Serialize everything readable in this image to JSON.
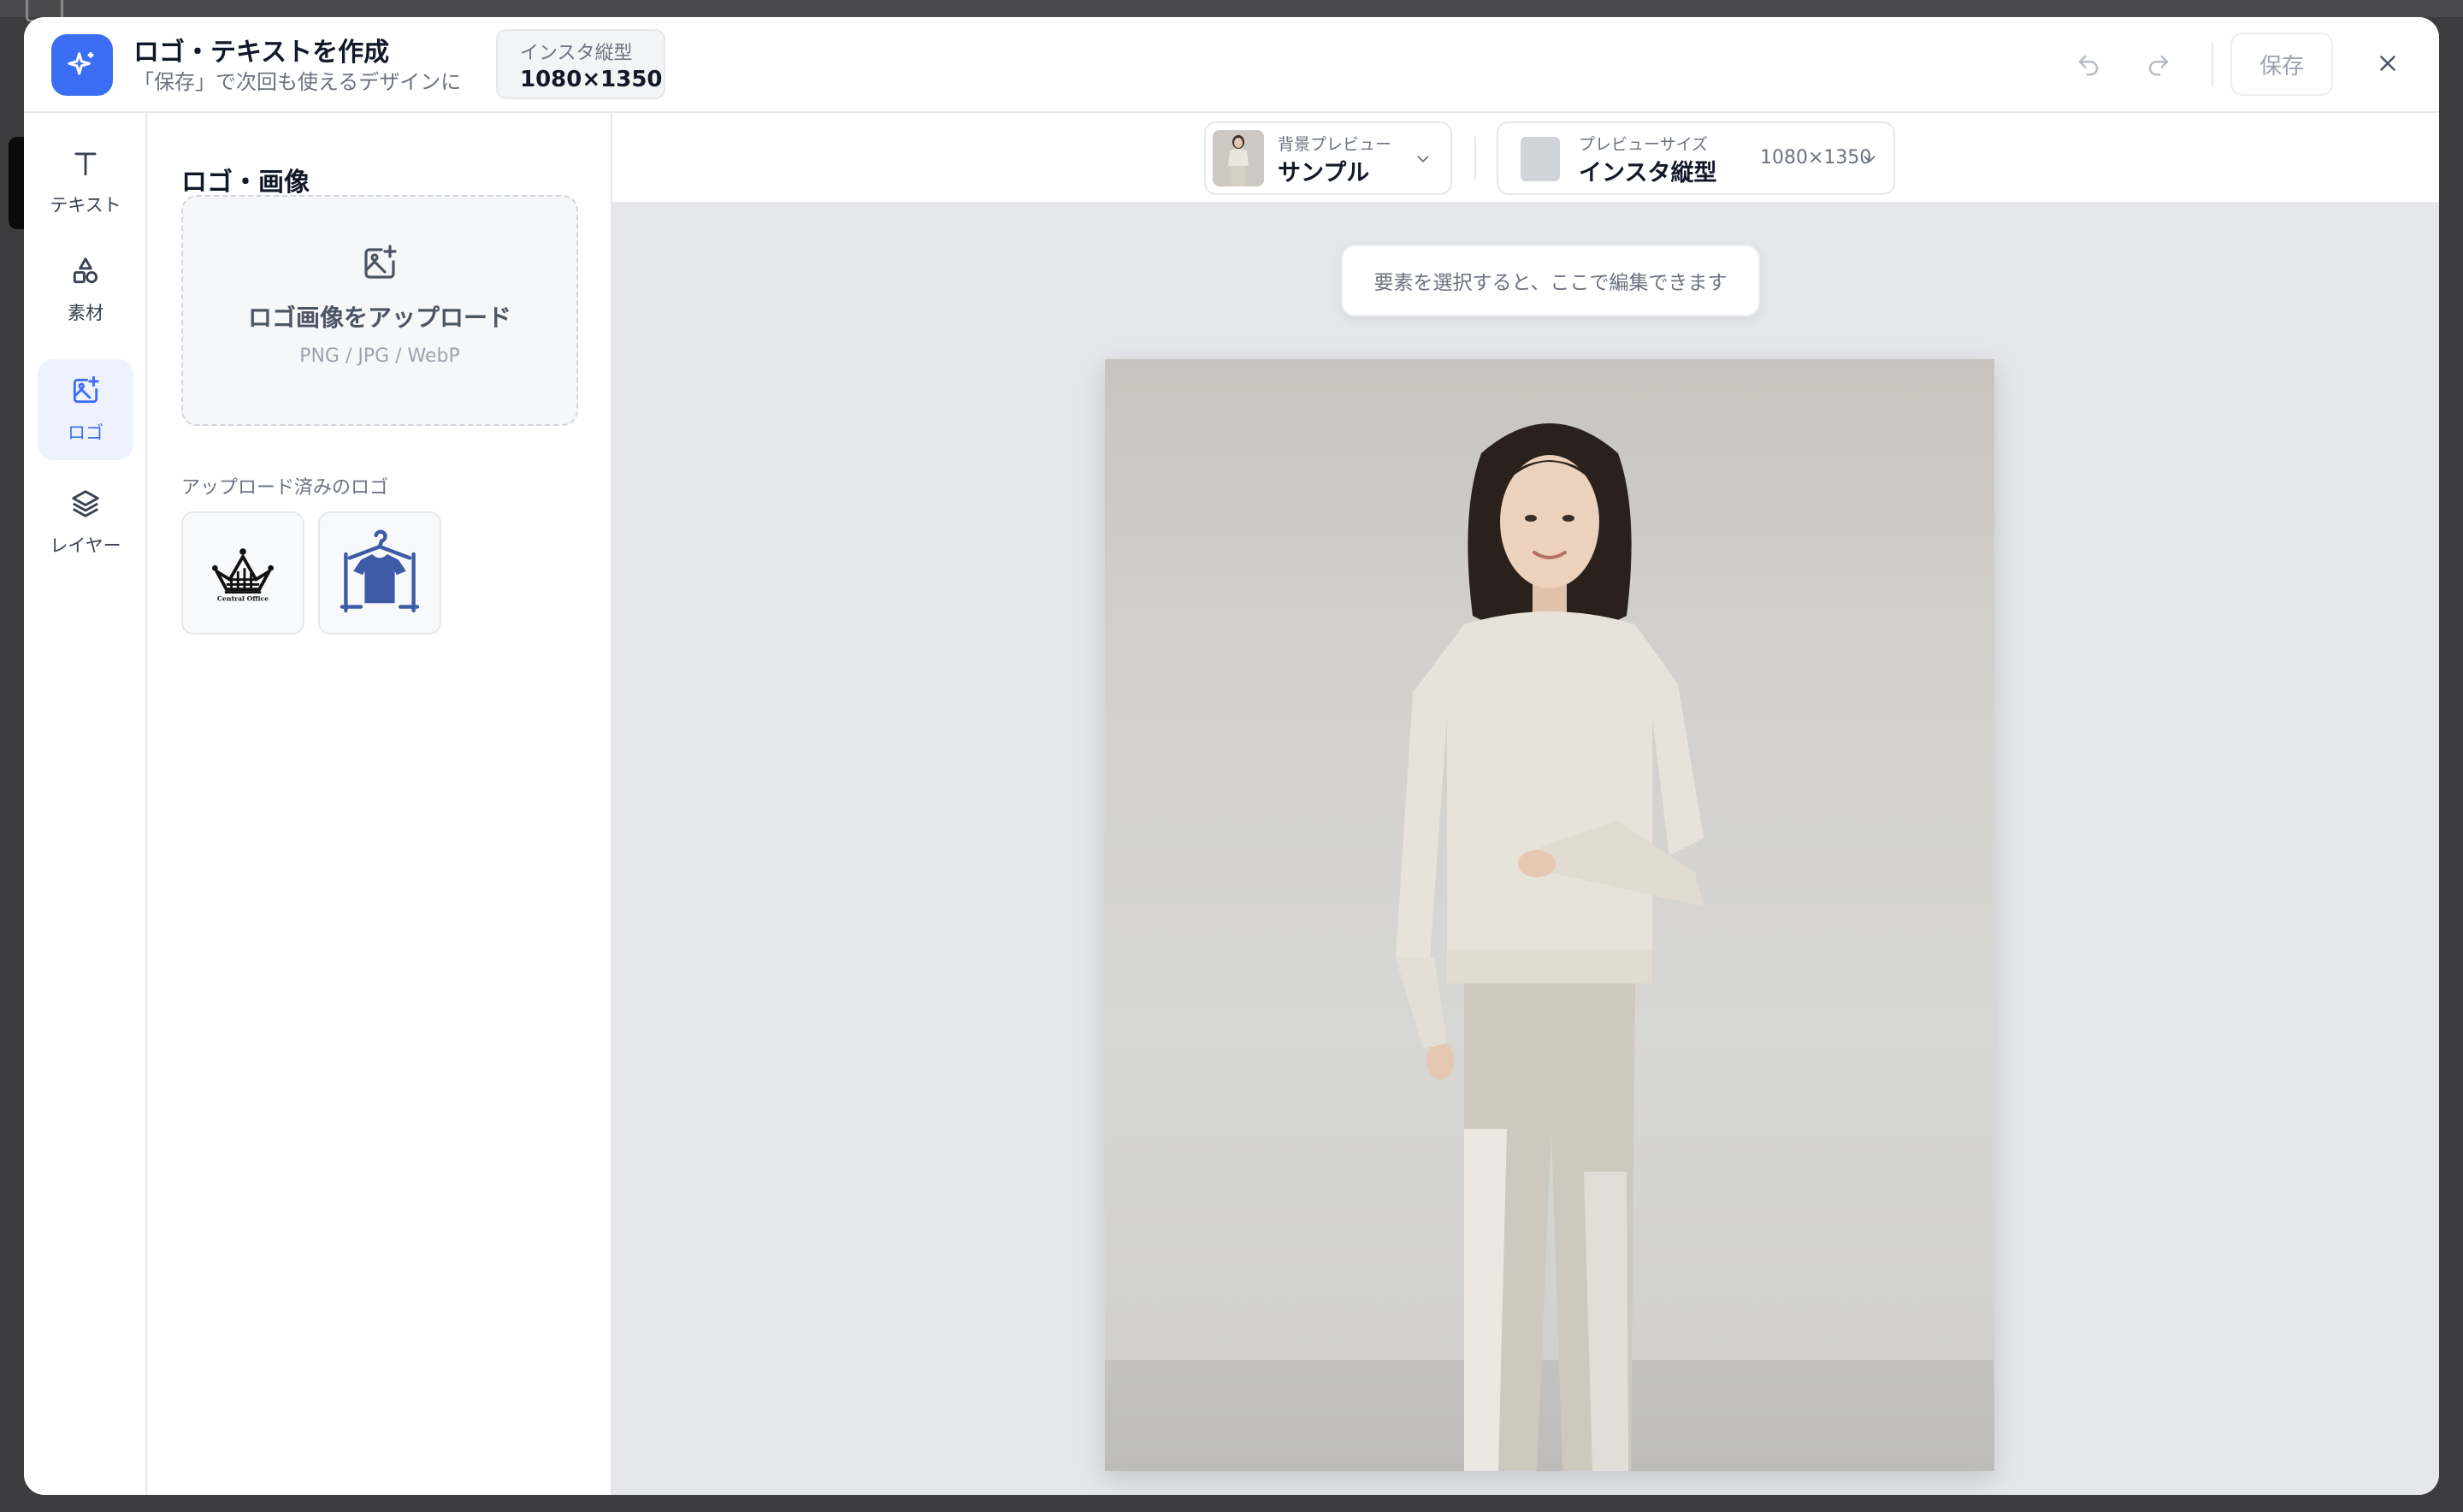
{
  "header": {
    "title": "ロゴ・テキストを作成",
    "subtitle": "「保存」で次回も使えるデザインに",
    "size_badge_label": "インスタ縦型",
    "size_badge_value": "1080×1350",
    "save_label": "保存"
  },
  "rail": {
    "items": [
      {
        "label": "テキスト",
        "icon": "text-icon"
      },
      {
        "label": "素材",
        "icon": "shapes-icon"
      },
      {
        "label": "ロゴ",
        "icon": "image-plus-icon",
        "active": true
      },
      {
        "label": "レイヤー",
        "icon": "layers-icon"
      }
    ]
  },
  "panel": {
    "title": "ロゴ・画像",
    "upload_label": "ロゴ画像をアップロード",
    "upload_hint": "PNG / JPG / WebP",
    "uploaded_label": "アップロード済みのロゴ",
    "logos": [
      {
        "name": "crown-logo",
        "text": "Central Office"
      },
      {
        "name": "hanger-shirt-logo"
      }
    ]
  },
  "toolbar": {
    "bg_preview_label": "背景プレビュー",
    "bg_preview_value": "サンプル",
    "size_label": "プレビューサイズ",
    "size_value": "インスタ縦型",
    "size_dims": "1080×1350"
  },
  "canvas": {
    "hint": "要素を選択すると、ここで編集できます"
  },
  "colors": {
    "accent": "#3b6ef5",
    "canvas_bg": "#e5e7eb",
    "sweater": "#e8e3da",
    "pants": "#cfc8be"
  }
}
